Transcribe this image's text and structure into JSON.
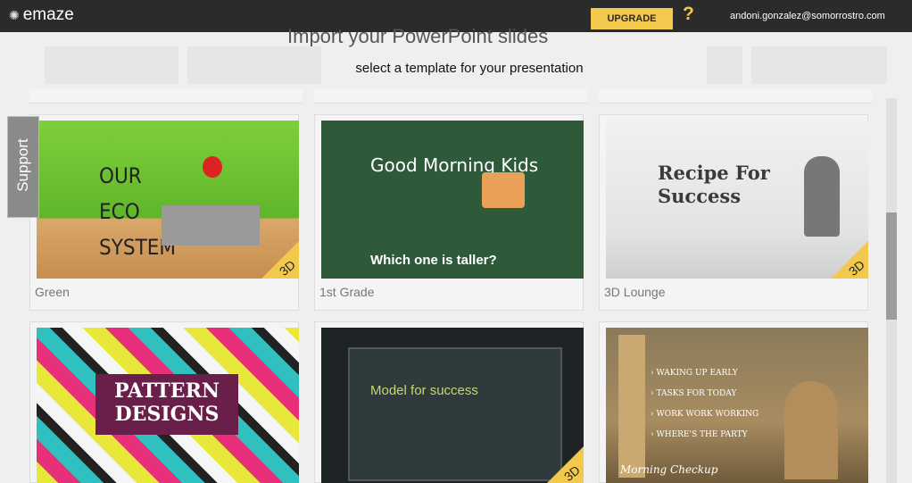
{
  "topbar": {
    "logo": "emaze",
    "upgrade_label": "UPGRADE",
    "help_label": "?",
    "user_email": "andoni.gonzalez@somorrostro.com"
  },
  "background": {
    "title": "Import your PowerPoint slides"
  },
  "modal": {
    "title": "select a template for your presentation"
  },
  "support_label": "Support",
  "templates": [
    {
      "label": "Green",
      "thumb_title": "OUR ECO SYSTEM",
      "badge": "3D"
    },
    {
      "label": "1st Grade",
      "thumb_title": "Good Morning Kids",
      "thumb_sub": "Which one is taller?",
      "badge": ""
    },
    {
      "label": "3D Lounge",
      "thumb_title": "Recipe For Success",
      "badge": "3D"
    },
    {
      "label": "",
      "thumb_title": "PATTERN DESIGNS",
      "badge": ""
    },
    {
      "label": "",
      "thumb_title": "Model for success",
      "badge": "3D"
    },
    {
      "label": "",
      "thumb_title": "Morning Checkup",
      "thumb_items": [
        "WAKING UP EARLY",
        "TASKS FOR TODAY",
        "WORK WORK WORKING",
        "WHERE'S THE PARTY"
      ],
      "badge": ""
    }
  ],
  "colors": {
    "topbar": "#2b2b2b",
    "accent": "#f2c94c"
  }
}
